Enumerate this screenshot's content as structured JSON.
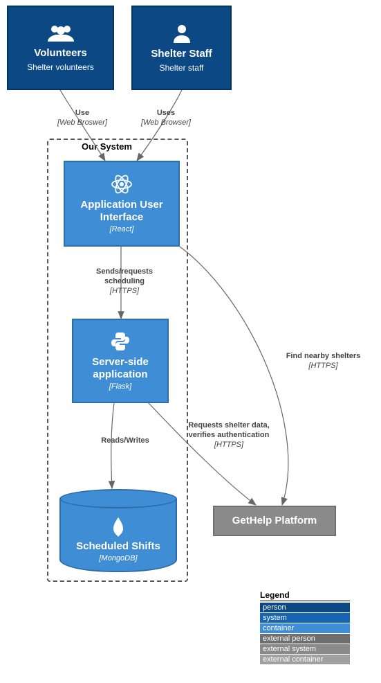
{
  "chart_data": {
    "type": "c4-container-diagram",
    "boundary": {
      "label": "Our System"
    },
    "nodes": [
      {
        "id": "volunteers",
        "kind": "person",
        "title": "Volunteers",
        "subtitle": "Shelter volunteers"
      },
      {
        "id": "staff",
        "kind": "person",
        "title": "Shelter Staff",
        "subtitle": "Shelter staff"
      },
      {
        "id": "ui",
        "kind": "container",
        "title": "Application User Interface",
        "tech": "[React]"
      },
      {
        "id": "server",
        "kind": "container",
        "title": "Server-side application",
        "tech": "[Flask]"
      },
      {
        "id": "db",
        "kind": "database",
        "title": "Scheduled Shifts",
        "tech": "[MongoDB]"
      },
      {
        "id": "gethelp",
        "kind": "external-system",
        "title": "GetHelp Platform"
      }
    ],
    "edges": [
      {
        "from": "volunteers",
        "to": "ui",
        "label": "Use",
        "tech": "[Web Broswer]"
      },
      {
        "from": "staff",
        "to": "ui",
        "label": "Uses",
        "tech": "[Web Browser]"
      },
      {
        "from": "ui",
        "to": "server",
        "label": "Sends/requests scheduling",
        "tech": "[HTTPS]"
      },
      {
        "from": "ui",
        "to": "gethelp",
        "label": "Find nearby shelters",
        "tech": "[HTTPS]"
      },
      {
        "from": "server",
        "to": "db",
        "label": "Reads/Writes",
        "tech": ""
      },
      {
        "from": "server",
        "to": "gethelp",
        "label": "Requests shelter data, verifies authentication",
        "tech": "[HTTPS]"
      }
    ],
    "legend": {
      "title": "Legend",
      "items": [
        {
          "label": "person",
          "color": "#0b4884"
        },
        {
          "label": "system",
          "color": "#1565b4"
        },
        {
          "label": "container",
          "color": "#3f8dd5"
        },
        {
          "label": "external person",
          "color": "#6e6e6e"
        },
        {
          "label": "external system",
          "color": "#8a8a8a"
        },
        {
          "label": "external container",
          "color": "#a0a0a0"
        }
      ]
    }
  }
}
